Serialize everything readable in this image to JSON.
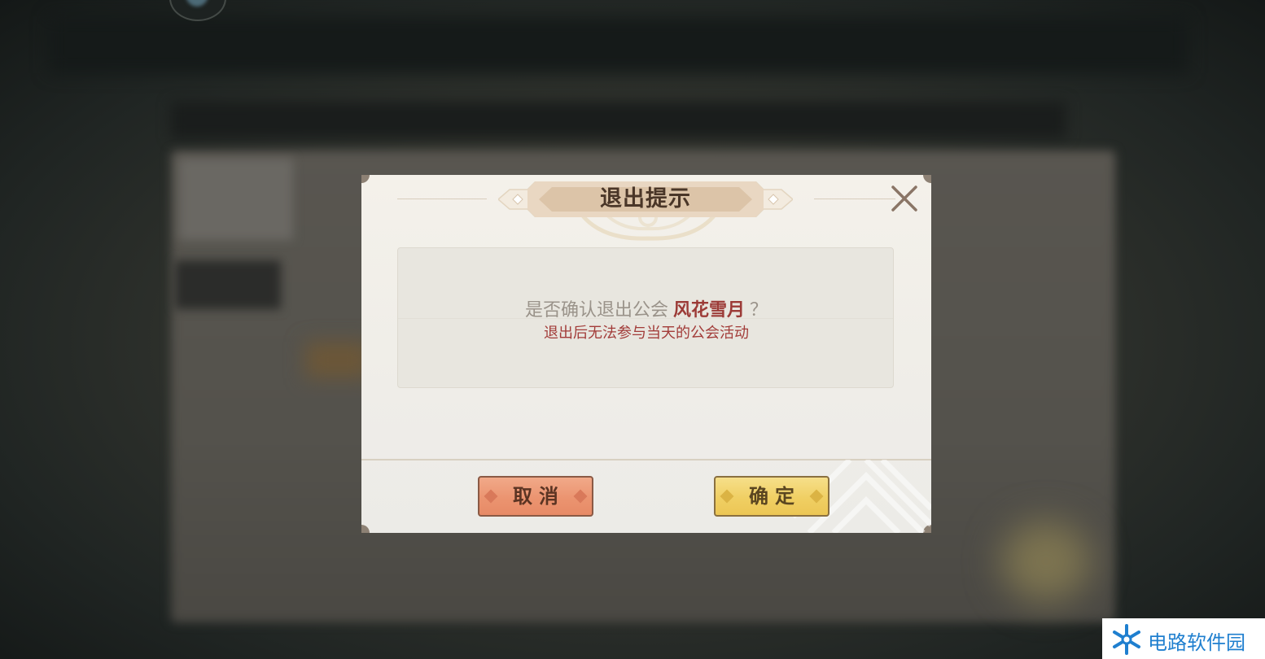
{
  "dialog": {
    "title": "退出提示",
    "confirm_prefix": "是否确认退出公会",
    "guild_name": "风花雪月",
    "confirm_suffix": "？",
    "warning": "退出后无法参与当天的公会活动",
    "cancel_label": "取消",
    "confirm_label": "确定",
    "close_icon": "close-icon"
  },
  "watermark": {
    "text": "电路软件园",
    "icon": "snowflake-logo-icon"
  },
  "colors": {
    "dialog_bg": "#f2efe9",
    "title_text": "#4a3628",
    "guild_name": "#9c3b37",
    "warning_text": "#a23c39",
    "cancel_button": "#eb9470",
    "confirm_button": "#f0cf63",
    "watermark_text": "#1f7fcf"
  }
}
